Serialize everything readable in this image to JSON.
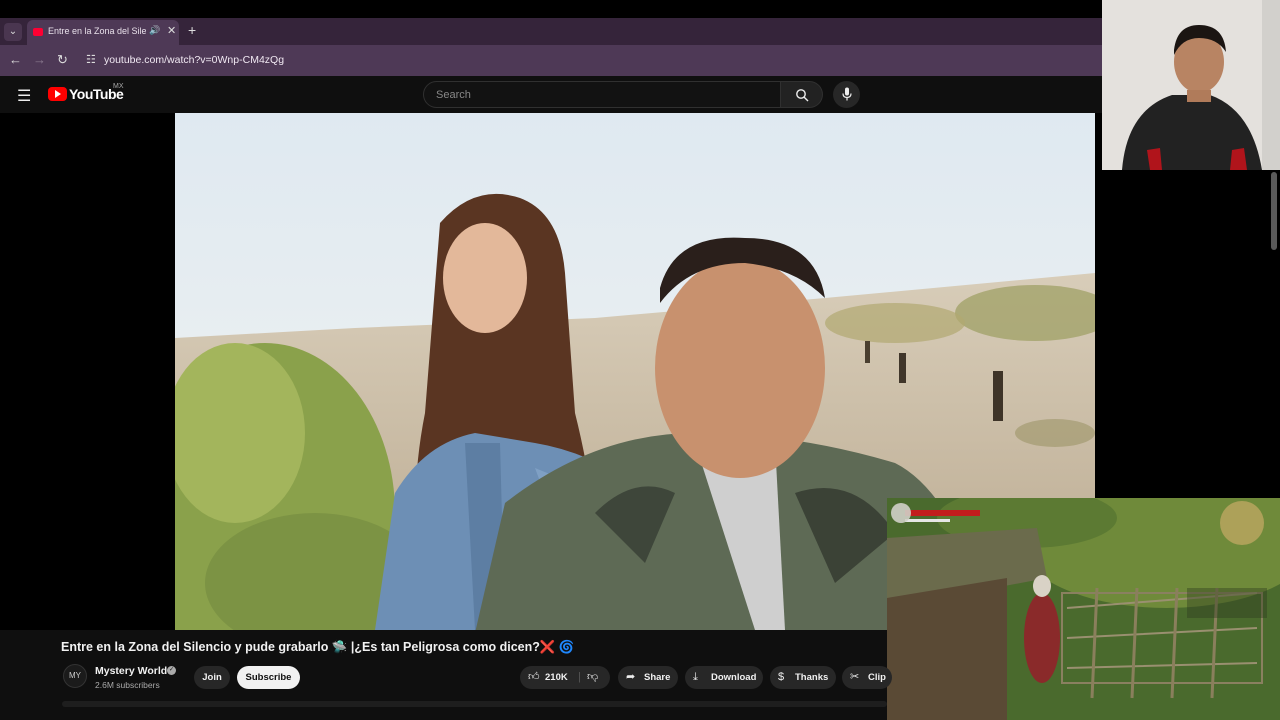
{
  "browser": {
    "tab_title": "Entre en la Zona del Silencio y pude grabarlo",
    "tab_audio_icon": "speaker-icon",
    "tab_close": "✕",
    "new_tab": "+",
    "url": "youtube.com/watch?v=0Wnp-CM4zQg"
  },
  "header": {
    "logo_text": "YouTube",
    "region": "MX",
    "search_placeholder": "Search"
  },
  "video": {
    "title": "Entre en la Zona del Silencio y pude grabarlo 🛸 |¿Es tan Peligrosa como dicen?❌ 🌀",
    "channel_name": "Mystery World",
    "channel_avatar": "MY",
    "subscribers": "2.6M subscribers",
    "join_label": "Join",
    "subscribe_label": "Subscribe",
    "likes": "210K",
    "share_label": "Share",
    "download_label": "Download",
    "thanks_label": "Thanks",
    "clip_label": "Clip"
  },
  "colors": {
    "youtube_red": "#ff0000",
    "browser_frame": "#4e3956",
    "page_bg": "#0f0f0f"
  }
}
